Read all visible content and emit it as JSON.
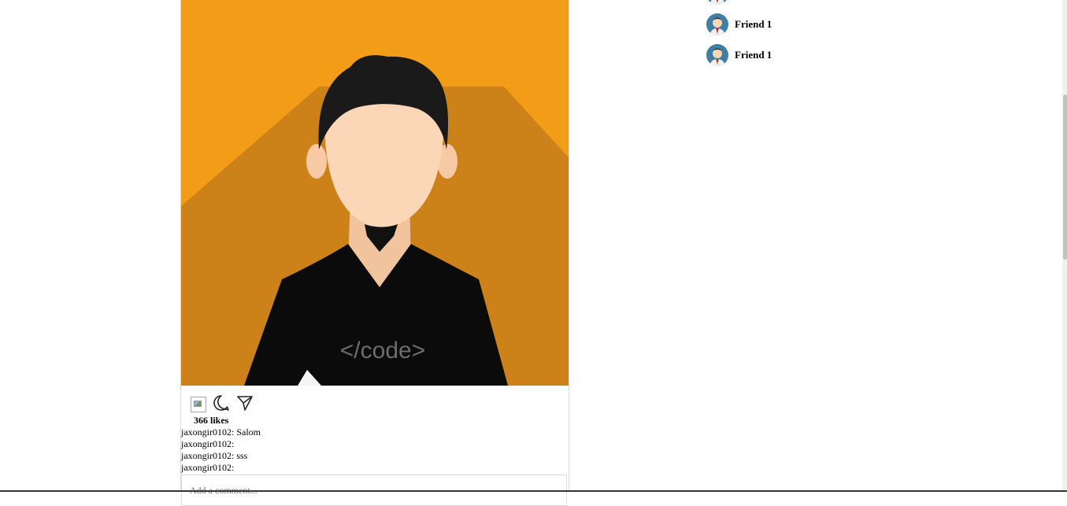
{
  "post": {
    "image_alt": "avatar illustration of a developer wearing a </code> shirt",
    "shirt_text": "</code>",
    "likes": "366 likes",
    "comments": [
      "jaxongir0102: Salom",
      "jaxongir0102:",
      "jaxongir0102: sss",
      "jaxongir0102:"
    ],
    "comment_placeholder": "Add a comment..."
  },
  "friends": [
    {
      "name": ""
    },
    {
      "name": "Friend 1"
    },
    {
      "name": "Friend 1"
    }
  ],
  "colors": {
    "image_bg": "#f39c17",
    "shadow": "#cc8218",
    "skin": "#fbd7b8",
    "hair": "#1a1a1a",
    "avatar_bg": "#3e7fa3"
  }
}
